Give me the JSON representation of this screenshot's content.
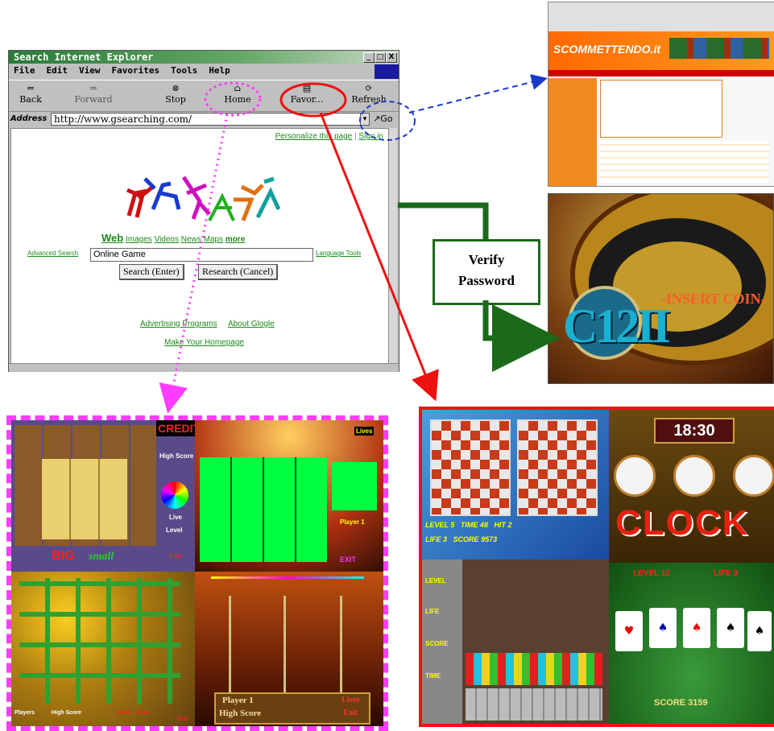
{
  "browser": {
    "title": "Search Internet Explorer",
    "window_buttons": [
      "_",
      "□",
      "X"
    ],
    "menu": [
      "File",
      "Edit",
      "View",
      "Favorites",
      "Tools",
      "Help"
    ],
    "toolbar": [
      {
        "label": "Back",
        "icon": "back-arrow-icon"
      },
      {
        "label": "Forward",
        "icon": "forward-arrow-icon"
      },
      {
        "label": "Stop",
        "icon": "stop-icon"
      },
      {
        "label": "Home",
        "icon": "home-icon"
      },
      {
        "label": "Favor...",
        "icon": "favorites-icon"
      },
      {
        "label": "Refresh",
        "icon": "refresh-icon"
      }
    ],
    "address_label": "Address",
    "address_value": "http://www.gsearching.com/",
    "go_label": "Go"
  },
  "page": {
    "personalize": "Personalize this page",
    "signin": "Sign in",
    "tabs": [
      "Web",
      "Images",
      "Videos",
      "News",
      "Maps",
      "more"
    ],
    "advanced_search": "Advanced Search",
    "search_value": "Online Game",
    "language_tools": "Language Tools",
    "search_button": "Search (Enter)",
    "research_button": "Research (Cancel)",
    "advertising": "Advertising Programs",
    "about": "About Glogle",
    "make_homepage": "Make Your Homepage"
  },
  "verify": {
    "line1": "Verify",
    "line2": "Password"
  },
  "site_shot": {
    "logo": "SCOMMETTENDO.it"
  },
  "roulette": {
    "insert_coin": "-INSERT COIN-",
    "logo": "C12II"
  },
  "games_left": {
    "credit": "CREDIT",
    "high_score": "High Score",
    "lives": "Lives",
    "live": "Live",
    "level": "Level",
    "exit": "Exit",
    "big": "BIG",
    "small": "small",
    "player1": "Player 1",
    "exit_caps": "EXIT",
    "players": "Players",
    "p1_label": "Player 1",
    "hs_label": "High Score",
    "lives2": "Lives",
    "exit2": "Exit",
    "level2": "Level",
    "lives3": "Lives"
  },
  "games_right": {
    "level": "LEVEL",
    "level_val": "5",
    "time": "TIME",
    "time_val": "48",
    "hit": "HIT",
    "hit_val": "2",
    "life": "LIFE",
    "life_val": "3",
    "score": "SCORE",
    "score_val": "9573",
    "clock_time": "18:30",
    "clock_word": "CLOCK",
    "card_level": "LEVEL 12",
    "card_life": "LIFE 3",
    "card_score": "SCORE 3159",
    "tetris_labels": [
      "LEVEL",
      "LIFE",
      "SCORE",
      "TIME"
    ]
  },
  "colors": {
    "highlight_red": "#ee1111",
    "highlight_magenta": "#ff3cff",
    "dashed_blue": "#1a3acc",
    "verify_green": "#1a6a1a",
    "link_green": "#1a8a1a"
  }
}
